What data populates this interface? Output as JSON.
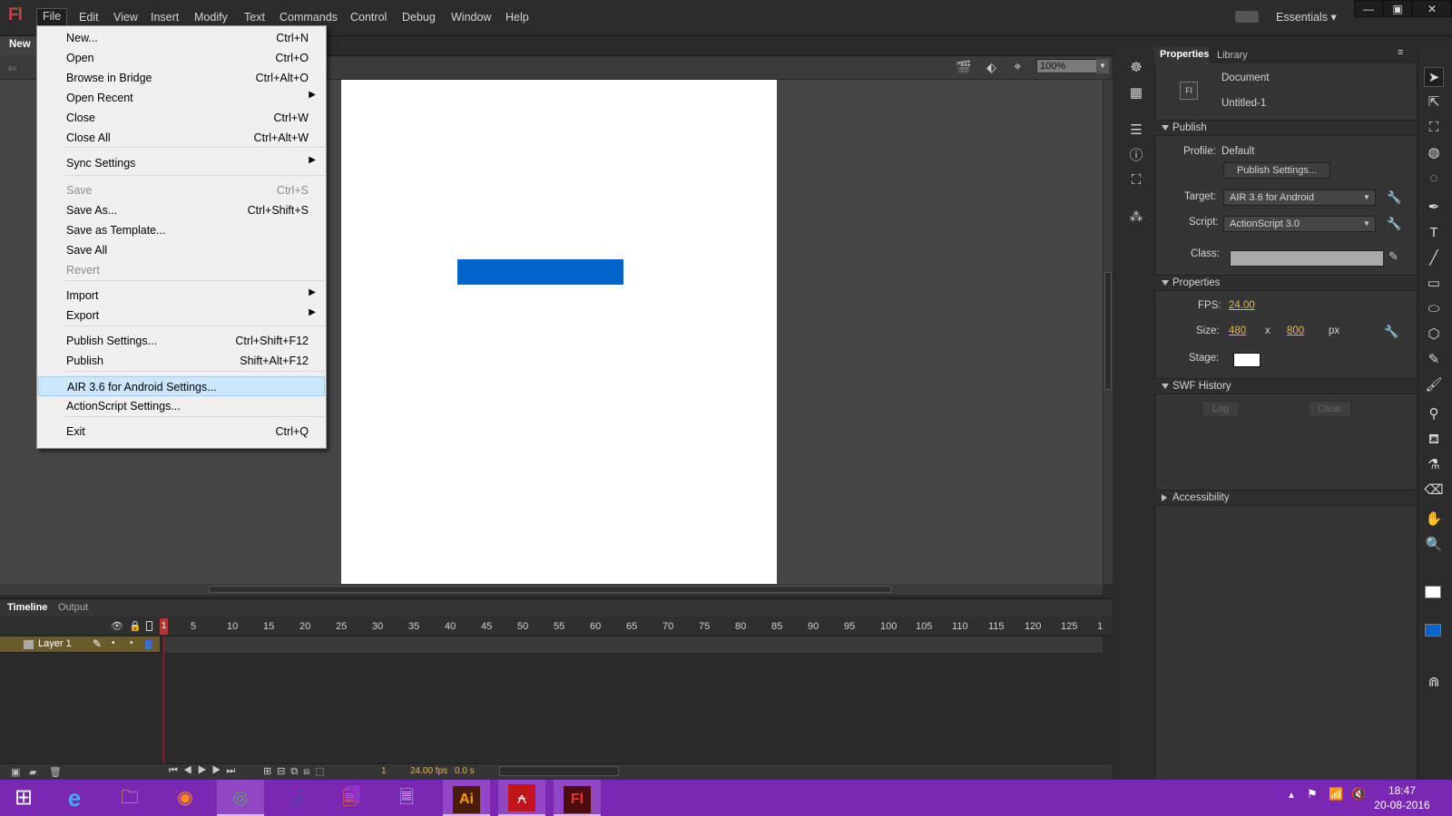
{
  "app": {
    "logo": "Fl",
    "workspace": "Essentials ▾"
  },
  "menubar": [
    "File",
    "Edit",
    "View",
    "Insert",
    "Modify",
    "Text",
    "Commands",
    "Control",
    "Debug",
    "Window",
    "Help"
  ],
  "window_controls": {
    "minimize": "—",
    "restore": "▣",
    "close": "✕"
  },
  "document_tab": "New",
  "zoom": "100%",
  "file_menu": [
    {
      "label": "New...",
      "shortcut": "Ctrl+N"
    },
    {
      "label": "Open",
      "shortcut": "Ctrl+O"
    },
    {
      "label": "Browse in Bridge",
      "shortcut": "Ctrl+Alt+O"
    },
    {
      "label": "Open Recent",
      "submenu": true
    },
    {
      "label": "Close",
      "shortcut": "Ctrl+W"
    },
    {
      "label": "Close All",
      "shortcut": "Ctrl+Alt+W"
    },
    {
      "label": "Sync Settings",
      "submenu": true
    },
    {
      "label": "Save",
      "shortcut": "Ctrl+S",
      "disabled": true
    },
    {
      "label": "Save As...",
      "shortcut": "Ctrl+Shift+S"
    },
    {
      "label": "Save as Template..."
    },
    {
      "label": "Save All"
    },
    {
      "label": "Revert",
      "disabled": true
    },
    {
      "label": "Import",
      "submenu": true
    },
    {
      "label": "Export",
      "submenu": true
    },
    {
      "label": "Publish Settings...",
      "shortcut": "Ctrl+Shift+F12"
    },
    {
      "label": "Publish",
      "shortcut": "Shift+Alt+F12"
    },
    {
      "label": "AIR 3.6 for Android Settings...",
      "highlighted": true
    },
    {
      "label": "ActionScript Settings..."
    },
    {
      "label": "Exit",
      "shortcut": "Ctrl+Q"
    }
  ],
  "timeline": {
    "tabs": [
      "Timeline",
      "Output"
    ],
    "ruler": [
      "1",
      "5",
      "10",
      "15",
      "20",
      "25",
      "30",
      "35",
      "40",
      "45",
      "50",
      "55",
      "60",
      "65",
      "70",
      "75",
      "80",
      "85",
      "90",
      "95",
      "100",
      "105",
      "110",
      "115",
      "120",
      "125",
      "1"
    ],
    "layer": "Layer 1",
    "current_frame": "1",
    "fps": "24.00 fps",
    "time": "0.0 s"
  },
  "properties_panel": {
    "tabs": [
      "Properties",
      "Library"
    ],
    "doc_type": "Document",
    "doc_name": "Untitled-1",
    "doc_icon": "Fl",
    "publish": {
      "header": "Publish",
      "profile_label": "Profile:",
      "profile_value": "Default",
      "settings_button": "Publish Settings...",
      "target_label": "Target:",
      "target_value": "AIR 3.6 for Android",
      "script_label": "Script:",
      "script_value": "ActionScript 3.0",
      "class_label": "Class:"
    },
    "properties": {
      "header": "Properties",
      "fps_label": "FPS:",
      "fps_value": "24.00",
      "size_label": "Size:",
      "width": "480",
      "x": "x",
      "height": "800",
      "unit": "px",
      "stage_label": "Stage:",
      "stage_color": "#ffffff"
    },
    "swf_history": {
      "header": "SWF History",
      "log_button": "Log",
      "clear_button": "Clear"
    },
    "accessibility": {
      "header": "Accessibility"
    }
  },
  "stage_shape_color": "#0066cc",
  "taskbar": {
    "clock_time": "18:47",
    "clock_date": "20-08-2016"
  }
}
